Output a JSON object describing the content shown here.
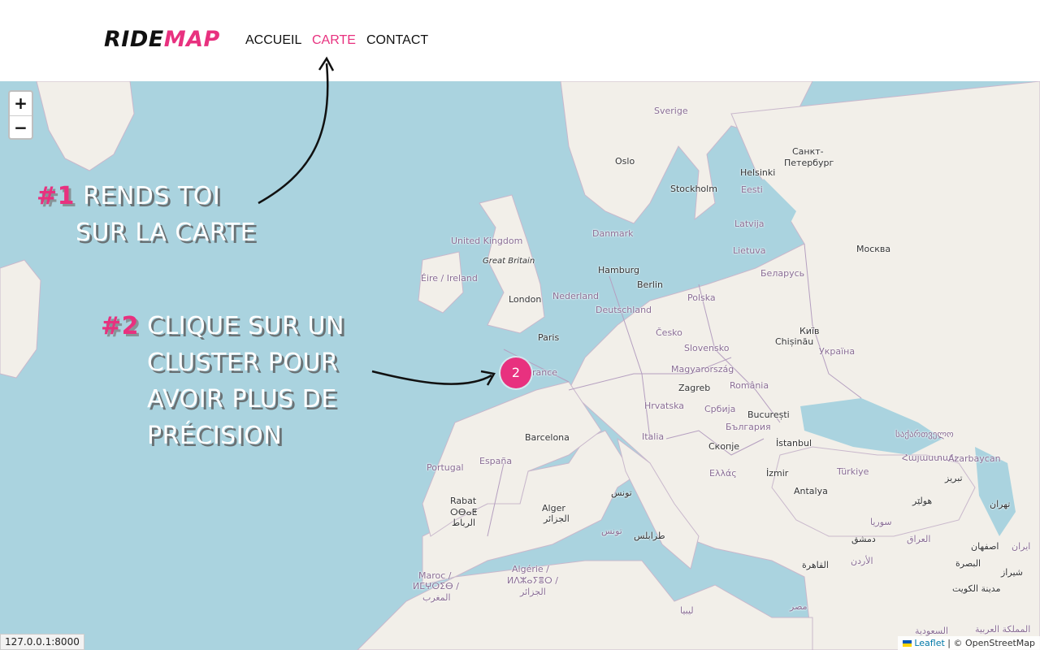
{
  "header": {
    "logo_part1": "RIDE",
    "logo_part2": "MAP",
    "nav": [
      {
        "label": "ACCUEIL",
        "active": false
      },
      {
        "label": "CARTE",
        "active": true
      },
      {
        "label": "CONTACT",
        "active": false
      }
    ]
  },
  "map": {
    "zoom_in": "+",
    "zoom_out": "−",
    "cluster_count": "2",
    "attribution_leaflet": "Leaflet",
    "attribution_rest": "| © OpenStreetMap",
    "labels": [
      {
        "text": "Sverige",
        "kind": "country"
      },
      {
        "text": "Oslo",
        "kind": "city"
      },
      {
        "text": "Helsinki",
        "kind": "city"
      },
      {
        "text": "Санкт-",
        "kind": "city"
      },
      {
        "text": "Петербург",
        "kind": "city"
      },
      {
        "text": "Stockholm",
        "kind": "city"
      },
      {
        "text": "Eesti",
        "kind": "country"
      },
      {
        "text": "Latvija",
        "kind": "country"
      },
      {
        "text": "Lietuva",
        "kind": "country"
      },
      {
        "text": "Danmark",
        "kind": "country"
      },
      {
        "text": "United Kingdom",
        "kind": "country"
      },
      {
        "text": "Great Britain",
        "kind": "island"
      },
      {
        "text": "Éire / Ireland",
        "kind": "country"
      },
      {
        "text": "Hamburg",
        "kind": "city"
      },
      {
        "text": "Москва",
        "kind": "city"
      },
      {
        "text": "Беларусь",
        "kind": "country"
      },
      {
        "text": "Berlin",
        "kind": "city"
      },
      {
        "text": "Nederland",
        "kind": "country"
      },
      {
        "text": "London",
        "kind": "city"
      },
      {
        "text": "Deutschland",
        "kind": "country"
      },
      {
        "text": "Polska",
        "kind": "country"
      },
      {
        "text": "Paris",
        "kind": "city"
      },
      {
        "text": "Česko",
        "kind": "country"
      },
      {
        "text": "Київ",
        "kind": "city"
      },
      {
        "text": "Slovensko",
        "kind": "country"
      },
      {
        "text": "Chișinău",
        "kind": "city"
      },
      {
        "text": "Україна",
        "kind": "country"
      },
      {
        "text": "rance",
        "kind": "country"
      },
      {
        "text": "Magyarország",
        "kind": "country"
      },
      {
        "text": "Zagreb",
        "kind": "city"
      },
      {
        "text": "România",
        "kind": "country"
      },
      {
        "text": "Hrvatska",
        "kind": "country"
      },
      {
        "text": "Србија",
        "kind": "country"
      },
      {
        "text": "București",
        "kind": "city"
      },
      {
        "text": "България",
        "kind": "country"
      },
      {
        "text": "Barcelona",
        "kind": "city"
      },
      {
        "text": "Italia",
        "kind": "country"
      },
      {
        "text": "Скопје",
        "kind": "city"
      },
      {
        "text": "İstanbul",
        "kind": "city"
      },
      {
        "text": "საქართველო",
        "kind": "country"
      },
      {
        "text": "Portugal",
        "kind": "country"
      },
      {
        "text": "España",
        "kind": "country"
      },
      {
        "text": "Ελλάς",
        "kind": "country"
      },
      {
        "text": "İzmir",
        "kind": "city"
      },
      {
        "text": "Türkiye",
        "kind": "country"
      },
      {
        "text": "Հայաստան",
        "kind": "country"
      },
      {
        "text": "Azarbaycan",
        "kind": "country"
      },
      {
        "text": "تبريز",
        "kind": "city"
      },
      {
        "text": "Antalya",
        "kind": "city"
      },
      {
        "text": "Rabat",
        "kind": "city"
      },
      {
        "text": "ⵔⴱⴰⵟ",
        "kind": "city"
      },
      {
        "text": "الرباط",
        "kind": "city"
      },
      {
        "text": "تونس",
        "kind": "city"
      },
      {
        "text": "Alger",
        "kind": "city"
      },
      {
        "text": "الجزائر",
        "kind": "city"
      },
      {
        "text": "تونس",
        "kind": "country"
      },
      {
        "text": "طرابلس",
        "kind": "city"
      },
      {
        "text": "هولێر",
        "kind": "city"
      },
      {
        "text": "تهران",
        "kind": "city"
      },
      {
        "text": "سوريا",
        "kind": "country"
      },
      {
        "text": "دمشق",
        "kind": "city"
      },
      {
        "text": "العراق",
        "kind": "country"
      },
      {
        "text": "اصفهان",
        "kind": "city"
      },
      {
        "text": "ایران",
        "kind": "country"
      },
      {
        "text": "الأردن",
        "kind": "country"
      },
      {
        "text": "البصرة",
        "kind": "city"
      },
      {
        "text": "Maroc /",
        "kind": "country"
      },
      {
        "text": "ⵍⵎⵖⵔⵉⴱ /",
        "kind": "country"
      },
      {
        "text": "المغرب",
        "kind": "country"
      },
      {
        "text": "Algérie /",
        "kind": "country"
      },
      {
        "text": "ⵍⴷⵣⴰⵢⴻⵔ /",
        "kind": "country"
      },
      {
        "text": "الجزائر",
        "kind": "country"
      },
      {
        "text": "القاهرة",
        "kind": "city"
      },
      {
        "text": "شيراز",
        "kind": "city"
      },
      {
        "text": "مدينة الكويت",
        "kind": "city"
      },
      {
        "text": "ليبيا",
        "kind": "country"
      },
      {
        "text": "مصر",
        "kind": "country"
      },
      {
        "text": "السعودية",
        "kind": "country"
      },
      {
        "text": "المملكة العربية",
        "kind": "country"
      }
    ]
  },
  "instructions": [
    {
      "number": "#1",
      "lines": [
        "RENDS TOI",
        "SUR LA CARTE"
      ]
    },
    {
      "number": "#2",
      "lines": [
        "CLIQUE SUR UN",
        "CLUSTER POUR",
        "AVOIR PLUS DE",
        "PRÉCISION"
      ]
    }
  ],
  "status_bar": "127.0.0.1:8000"
}
